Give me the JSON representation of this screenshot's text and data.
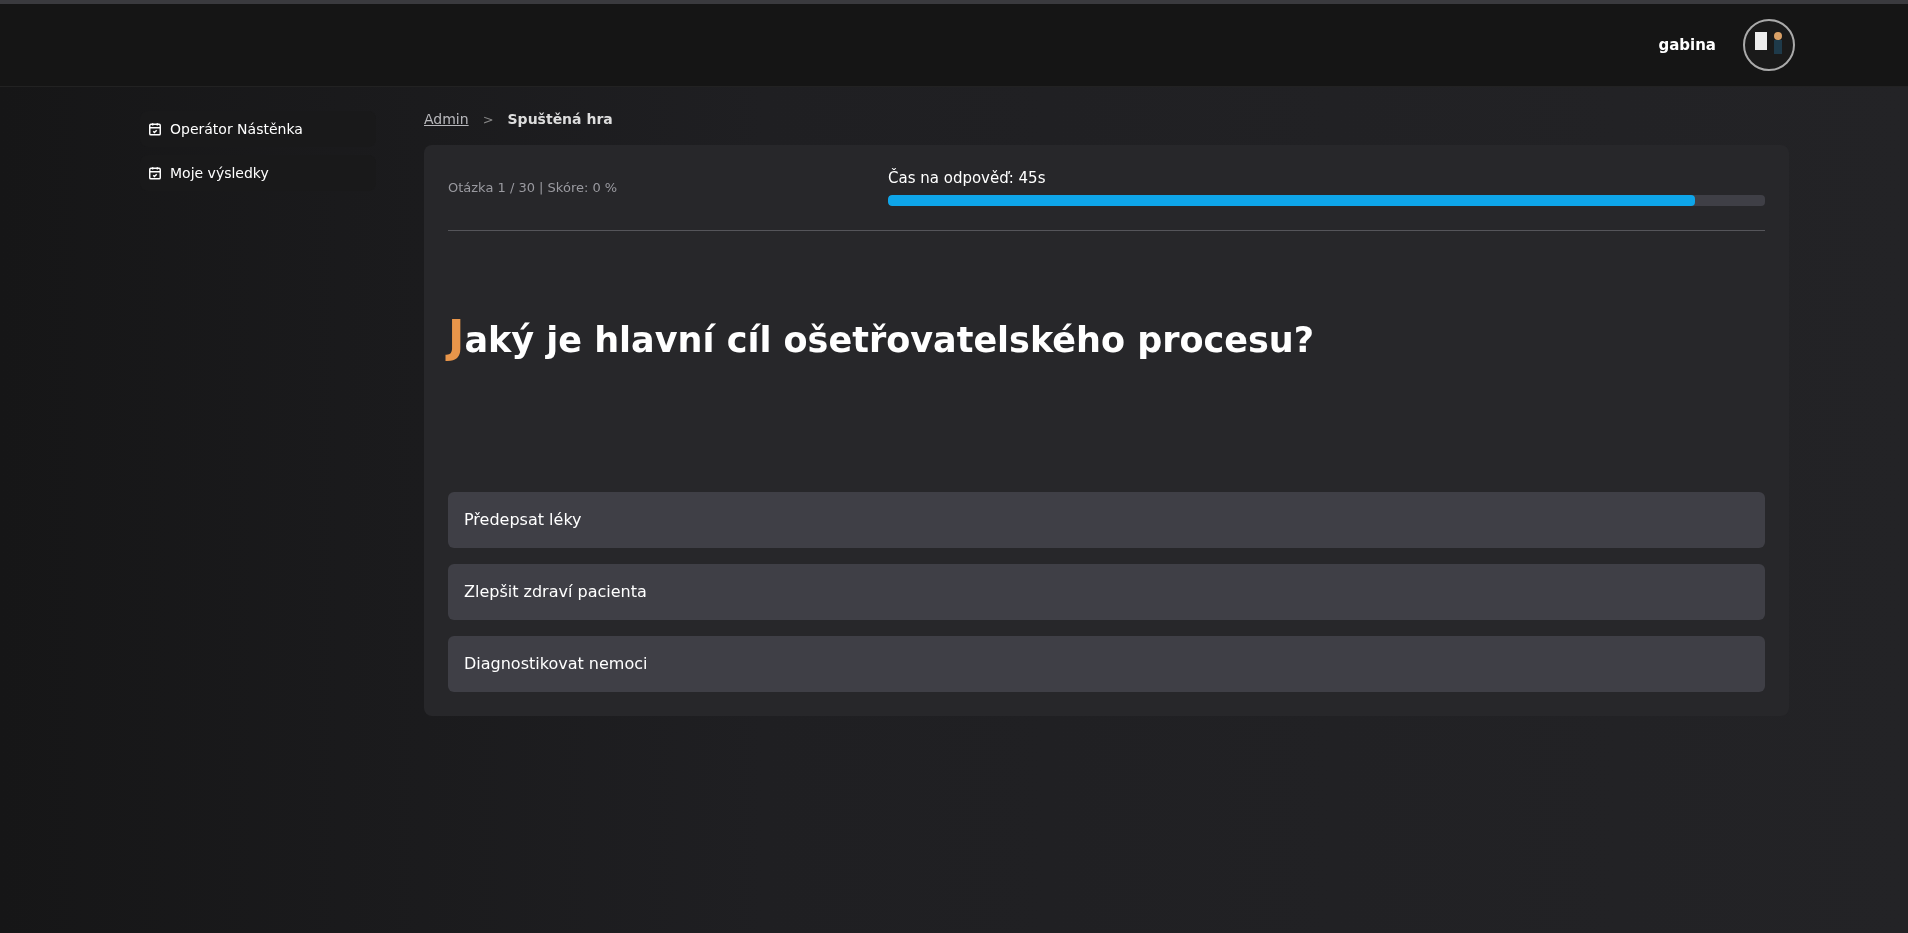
{
  "header": {
    "username": "gabina"
  },
  "sidebar": {
    "items": [
      {
        "label": "Operátor Nástěnka"
      },
      {
        "label": "Moje výsledky"
      }
    ]
  },
  "breadcrumb": {
    "link": "Admin",
    "separator": ">",
    "current": "Spuštěná hra"
  },
  "game": {
    "status": "Otázka 1 / 30 | Skóre: 0 %",
    "timer_label": "Čas na odpověď: 45s",
    "timer": {
      "level": 0.92
    },
    "question": "Jaký je hlavní cíl ošetřovatelského procesu?",
    "answers": [
      {
        "label": "Předepsat léky"
      },
      {
        "label": "Zlepšit zdraví pacienta"
      },
      {
        "label": "Diagnostikovat nemoci"
      }
    ]
  }
}
